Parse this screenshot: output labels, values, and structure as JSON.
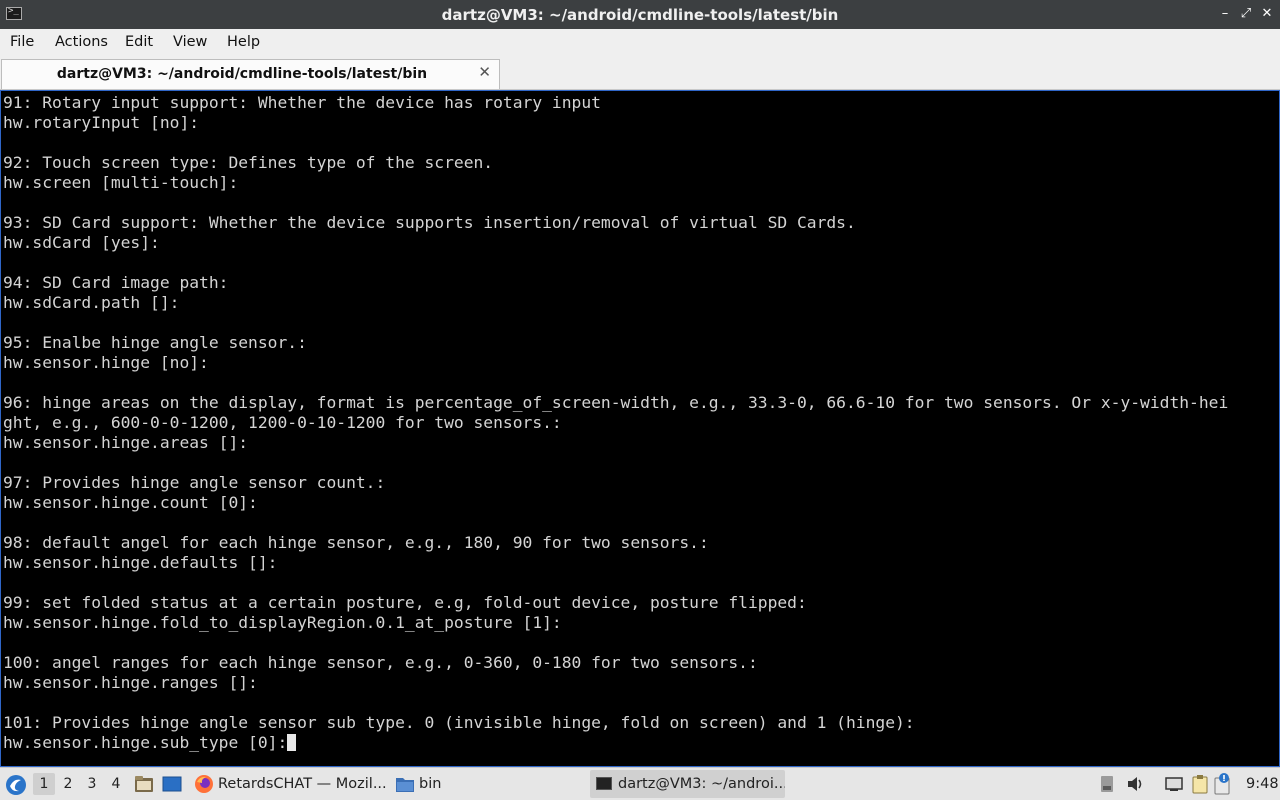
{
  "window": {
    "title": "dartz@VM3: ~/android/cmdline-tools/latest/bin",
    "minimize_glyph": "–",
    "maximize_glyph": "⤢",
    "close_glyph": "✕"
  },
  "menu": [
    "File",
    "Actions",
    "Edit",
    "View",
    "Help"
  ],
  "tab": {
    "label": "dartz@VM3: ~/android/cmdline-tools/latest/bin",
    "close_glyph": "✕"
  },
  "terminal": {
    "lines": [
      "91: Rotary input support: Whether the device has rotary input",
      "hw.rotaryInput [no]:",
      "",
      "92: Touch screen type: Defines type of the screen.",
      "hw.screen [multi-touch]:",
      "",
      "93: SD Card support: Whether the device supports insertion/removal of virtual SD Cards.",
      "hw.sdCard [yes]:",
      "",
      "94: SD Card image path:",
      "hw.sdCard.path []:",
      "",
      "95: Enalbe hinge angle sensor.:",
      "hw.sensor.hinge [no]:",
      "",
      "96: hinge areas on the display, format is percentage_of_screen-width, e.g., 33.3-0, 66.6-10 for two sensors. Or x-y-width-hei",
      "ght, e.g., 600-0-0-1200, 1200-0-10-1200 for two sensors.:",
      "hw.sensor.hinge.areas []:",
      "",
      "97: Provides hinge angle sensor count.:",
      "hw.sensor.hinge.count [0]:",
      "",
      "98: default angel for each hinge sensor, e.g., 180, 90 for two sensors.:",
      "hw.sensor.hinge.defaults []:",
      "",
      "99: set folded status at a certain posture, e.g, fold-out device, posture flipped:",
      "hw.sensor.hinge.fold_to_displayRegion.0.1_at_posture [1]:",
      "",
      "100: angel ranges for each hinge sensor, e.g., 0-360, 0-180 for two sensors.:",
      "hw.sensor.hinge.ranges []:",
      "",
      "101: Provides hinge angle sensor sub type. 0 (invisible hinge, fold on screen) and 1 (hinge):"
    ],
    "prompt_line": "hw.sensor.hinge.sub_type [0]:"
  },
  "taskbar": {
    "workspaces": [
      "1",
      "2",
      "3",
      "4"
    ],
    "tasks": {
      "firefox": "RetardsCHAT — Mozil...",
      "files": "bin",
      "terminal": "dartz@VM3: ~/androi..."
    },
    "clock": "9:48",
    "colors": {
      "accent": "#2f66c8",
      "firefox": "#ff7139"
    }
  }
}
